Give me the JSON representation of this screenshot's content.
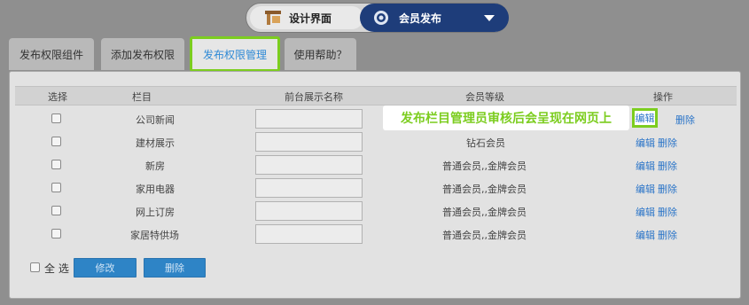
{
  "toggle": {
    "design_label": "设计界面",
    "publish_label": "会员发布"
  },
  "tabs": [
    {
      "label": "发布权限组件"
    },
    {
      "label": "添加发布权限"
    },
    {
      "label": "发布权限管理"
    },
    {
      "label": "使用帮助？"
    }
  ],
  "table": {
    "headers": {
      "select": "选择",
      "column": "栏目",
      "frontname": "前台展示名称",
      "level": "会员等级",
      "action": "操作"
    },
    "rows": [
      {
        "column": "公司新闻",
        "level": "",
        "edit": "编辑",
        "delete": "删除"
      },
      {
        "column": "建材展示",
        "level": "钻石会员",
        "edit": "编辑",
        "delete": "删除"
      },
      {
        "column": "新房",
        "level": "普通会员,,金牌会员",
        "edit": "编辑",
        "delete": "删除"
      },
      {
        "column": "家用电器",
        "level": "普通会员,,金牌会员",
        "edit": "编辑",
        "delete": "删除"
      },
      {
        "column": "网上订房",
        "level": "普通会员,,金牌会员",
        "edit": "编辑",
        "delete": "删除"
      },
      {
        "column": "家居特供场",
        "level": "普通会员,,金牌会员",
        "edit": "编辑",
        "delete": "删除"
      }
    ]
  },
  "footer": {
    "select_all": "全 选",
    "modify": "修改",
    "delete": "删除"
  },
  "callout": {
    "text": "发布栏目管理员审核后会呈现在网页上",
    "highlight": "编辑"
  },
  "colors": {
    "accent_green": "#7ccd1f",
    "link_blue": "#2a74c8",
    "toggle_navy": "#1e3d7a",
    "button_blue": "#2e84c6"
  }
}
